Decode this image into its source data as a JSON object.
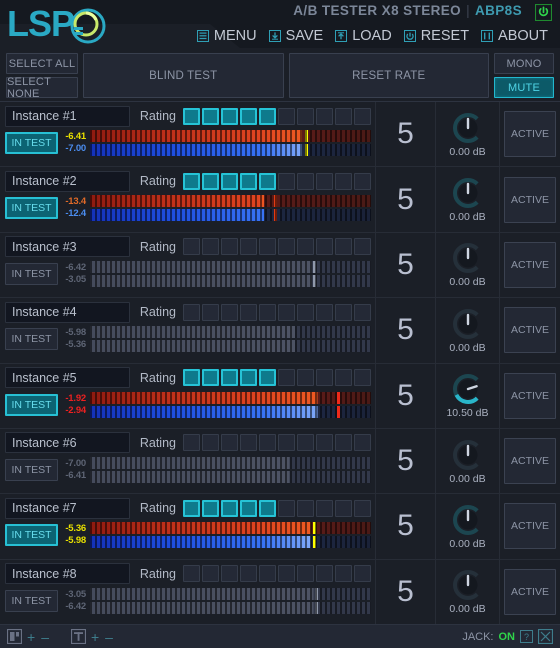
{
  "header": {
    "logo_text": "LSP",
    "logo_knob_icon": "knob-icon",
    "title": "A/B TESTER X8 STEREO",
    "separator": "|",
    "plugin_id": "ABP8S",
    "power_icon": "power-icon",
    "menu": [
      {
        "label": "MENU",
        "icon": "hamburger-icon"
      },
      {
        "label": "SAVE",
        "icon": "download-icon"
      },
      {
        "label": "LOAD",
        "icon": "upload-icon"
      },
      {
        "label": "RESET",
        "icon": "reset-icon"
      },
      {
        "label": "ABOUT",
        "icon": "info-icon"
      }
    ]
  },
  "toolbar": {
    "select_all": "SELECT ALL",
    "select_none": "SELECT NONE",
    "blind_test": "BLIND TEST",
    "reset_rate": "RESET RATE",
    "mono": "MONO",
    "mute": "MUTE",
    "mute_on": true,
    "mono_on": false
  },
  "labels": {
    "rating": "Rating",
    "in_test": "IN TEST",
    "active": "ACTIVE"
  },
  "colors": {
    "accent": "#26c3d6",
    "accent_dark": "#0e7a8c",
    "yellow": "#e8e000",
    "orange": "#e06a28",
    "red": "#ec2020",
    "blue": "#4b8df0",
    "green": "#2fd44a",
    "muted": "#5d6474",
    "panel": "#1b1f27"
  },
  "rating_cells": 10,
  "instances": [
    {
      "name": "Instance #1",
      "rating": 5,
      "in_test": true,
      "active": false,
      "number": "5",
      "gain": "0.00 dB",
      "gain_angle": 0,
      "top_value": "-6.41",
      "top_color": "#e8e000",
      "bot_value": "-7.00",
      "bot_color": "#4b8df0",
      "top_level": 75.5,
      "bot_level": 75.5,
      "peak": 76.5,
      "peak_color": "#ffff00",
      "lit": true
    },
    {
      "name": "Instance #2",
      "rating": 5,
      "in_test": true,
      "active": false,
      "number": "5",
      "gain": "0.00 dB",
      "gain_angle": 0,
      "top_value": "-13.4",
      "top_color": "#e06a28",
      "bot_value": "-12.4",
      "bot_color": "#4b8df0",
      "top_level": 62.0,
      "bot_level": 62.0,
      "peak": 65.5,
      "peak_color": "#e23b14",
      "lit": true
    },
    {
      "name": "Instance #3",
      "rating": 0,
      "in_test": false,
      "active": false,
      "number": "5",
      "gain": "0.00 dB",
      "gain_angle": 0,
      "top_value": "-6.42",
      "top_color": "#5d6474",
      "bot_value": "-3.05",
      "bot_color": "#5d6474",
      "top_level": 79.0,
      "bot_level": 79.0,
      "peak": 79.5,
      "peak_color": "#9099ab",
      "lit": false
    },
    {
      "name": "Instance #4",
      "rating": 0,
      "in_test": false,
      "active": false,
      "number": "5",
      "gain": "0.00 dB",
      "gain_angle": 0,
      "top_value": "-5.98",
      "top_color": "#5d6474",
      "bot_value": "-5.36",
      "bot_color": "#5d6474",
      "top_level": 73.0,
      "bot_level": 73.0,
      "peak": 0,
      "peak_color": "#9099ab",
      "lit": false
    },
    {
      "name": "Instance #5",
      "rating": 5,
      "in_test": true,
      "active": false,
      "number": "5",
      "gain": "10.50 dB",
      "gain_angle": 72,
      "top_value": "-1.92",
      "top_color": "#ec2020",
      "bot_value": "-2.94",
      "bot_color": "#ec2020",
      "top_level": 81.0,
      "bot_level": 81.0,
      "peak": 88.0,
      "peak_color": "#ee2a1a",
      "lit": true
    },
    {
      "name": "Instance #6",
      "rating": 0,
      "in_test": false,
      "active": false,
      "number": "5",
      "gain": "0.00 dB",
      "gain_angle": 0,
      "top_value": "-7.00",
      "top_color": "#5d6474",
      "bot_value": "-6.41",
      "bot_color": "#5d6474",
      "top_level": 71.0,
      "bot_level": 71.0,
      "peak": 0,
      "peak_color": "#9099ab",
      "lit": false
    },
    {
      "name": "Instance #7",
      "rating": 5,
      "in_test": true,
      "active": false,
      "number": "5",
      "gain": "0.00 dB",
      "gain_angle": 0,
      "top_value": "-5.36",
      "top_color": "#e8e000",
      "bot_value": "-5.98",
      "bot_color": "#e8e000",
      "top_level": 78.5,
      "bot_level": 78.5,
      "peak": 79.5,
      "peak_color": "#ffff00",
      "lit": true
    },
    {
      "name": "Instance #8",
      "rating": 0,
      "in_test": false,
      "active": false,
      "number": "5",
      "gain": "0.00 dB",
      "gain_angle": 0,
      "top_value": "-3.05",
      "top_color": "#5d6474",
      "bot_value": "-6.42",
      "bot_color": "#5d6474",
      "top_level": 79.5,
      "bot_level": 79.5,
      "peak": 80.0,
      "peak_color": "#9099ab",
      "lit": false
    }
  ],
  "footer": {
    "pane_icon": "pane-split-icon",
    "text_icon": "text-size-icon",
    "plus": "+",
    "minus": "–",
    "jack_label": "JACK:",
    "jack_state": "ON",
    "help_icon": "question-icon",
    "resize_icon": "resize-icon"
  }
}
